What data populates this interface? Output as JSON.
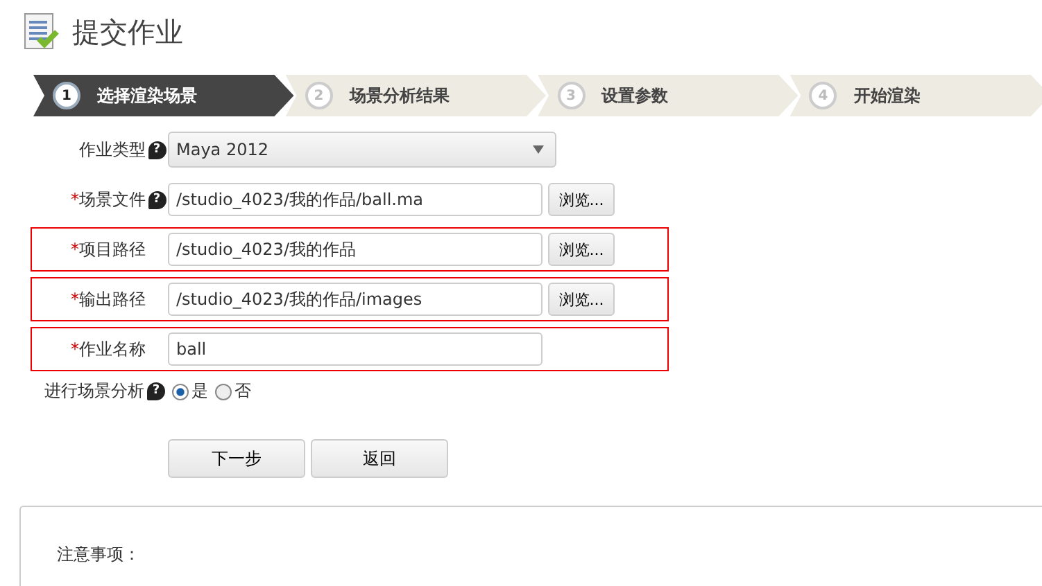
{
  "page_title": "提交作业",
  "steps": [
    {
      "number": "1",
      "label": "选择渲染场景",
      "selected": true
    },
    {
      "number": "2",
      "label": "场景分析结果",
      "selected": false
    },
    {
      "number": "3",
      "label": "设置参数",
      "selected": false
    },
    {
      "number": "4",
      "label": "开始渲染",
      "selected": false
    }
  ],
  "form": [
    {
      "kind": "select",
      "label": "作业类型",
      "help": "?",
      "highlighted": false,
      "value": "Maya 2012"
    },
    {
      "kind": "path",
      "required_mark": "*",
      "label": "场景文件",
      "help": "?",
      "highlighted": false,
      "value": "/studio_4023/我的作品/ball.ma",
      "button": "浏览..."
    },
    {
      "kind": "path",
      "required_mark": "*",
      "label": "项目路径",
      "highlighted": true,
      "value": "/studio_4023/我的作品",
      "button": "浏览..."
    },
    {
      "kind": "path",
      "required_mark": "*",
      "label": "输出路径",
      "highlighted": true,
      "value": "/studio_4023/我的作品/images",
      "button": "浏览..."
    },
    {
      "kind": "text",
      "required_mark": "*",
      "label": "作业名称",
      "highlighted": true,
      "value": "ball"
    }
  ],
  "scene_analysis": {
    "label": "进行场景分析",
    "help": "?",
    "options": [
      {
        "label": "是",
        "selected": true
      },
      {
        "label": "否",
        "selected": false
      }
    ]
  },
  "buttons": [
    "下一步",
    "返回"
  ],
  "notice": {
    "title": "注意事项："
  }
}
